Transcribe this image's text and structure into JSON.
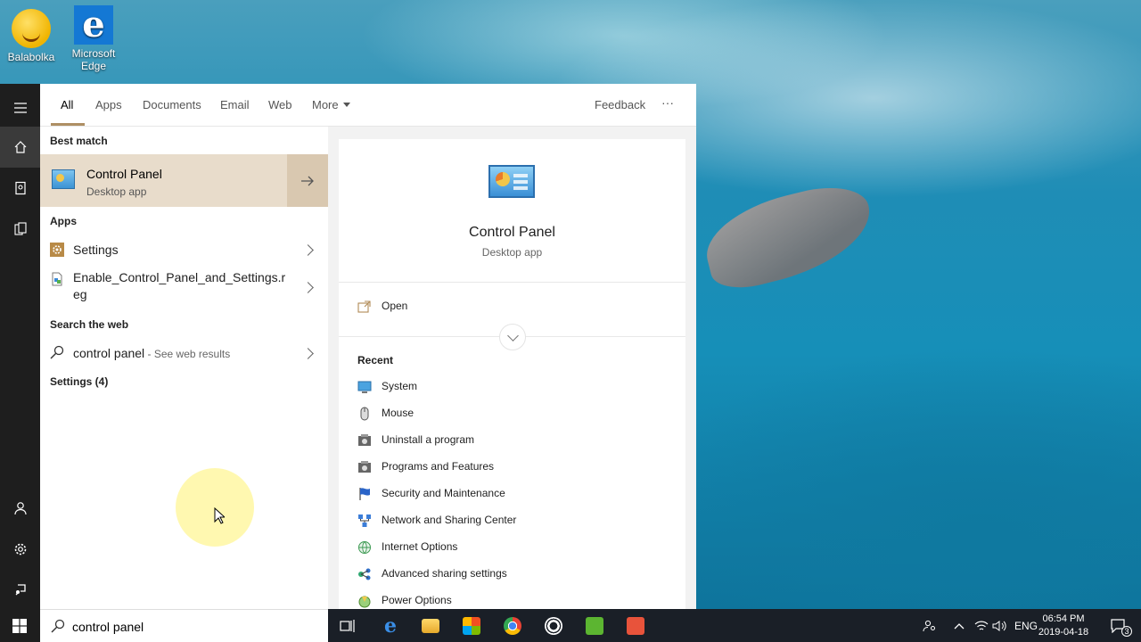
{
  "desktop": {
    "icons": [
      {
        "name": "balabolka",
        "label": "Balabolka"
      },
      {
        "name": "microsoft-edge",
        "label": "Microsoft Edge"
      }
    ]
  },
  "tabs": {
    "all": "All",
    "apps": "Apps",
    "documents": "Documents",
    "email": "Email",
    "web": "Web",
    "more": "More",
    "feedback": "Feedback",
    "overflow": "···"
  },
  "results": {
    "best_match_label": "Best match",
    "best_match": {
      "title": "Control Panel",
      "subtitle": "Desktop app"
    },
    "apps_label": "Apps",
    "apps": [
      {
        "name_plain": "Settings"
      },
      {
        "name_plain": "Enable_Control_Panel_and_Settings.reg"
      }
    ],
    "web_label": "Search the web",
    "web_query": "control panel",
    "web_suffix": " - See web results",
    "settings_label": "Settings (4)"
  },
  "detail": {
    "title": "Control Panel",
    "subtitle": "Desktop app",
    "open_label": "Open",
    "recent_label": "Recent",
    "recent": [
      {
        "label": "System",
        "icon": "system-icon"
      },
      {
        "label": "Mouse",
        "icon": "mouse-icon"
      },
      {
        "label": "Uninstall a program",
        "icon": "programs-icon"
      },
      {
        "label": "Programs and Features",
        "icon": "programs-icon"
      },
      {
        "label": "Security and Maintenance",
        "icon": "flag-icon"
      },
      {
        "label": "Network and Sharing Center",
        "icon": "network-icon"
      },
      {
        "label": "Internet Options",
        "icon": "globe-icon"
      },
      {
        "label": "Advanced sharing settings",
        "icon": "sharing-icon"
      },
      {
        "label": "Power Options",
        "icon": "power-icon"
      }
    ]
  },
  "search": {
    "value": "control panel"
  },
  "taskbar": {
    "language": "ENG",
    "time": "06:54 PM",
    "date": "2019-04-18",
    "notification_count": "3"
  },
  "colors": {
    "accent": "#ae8f64",
    "best_match_bg": "#e8dccb",
    "taskbar_bg": "#1a1f27"
  }
}
